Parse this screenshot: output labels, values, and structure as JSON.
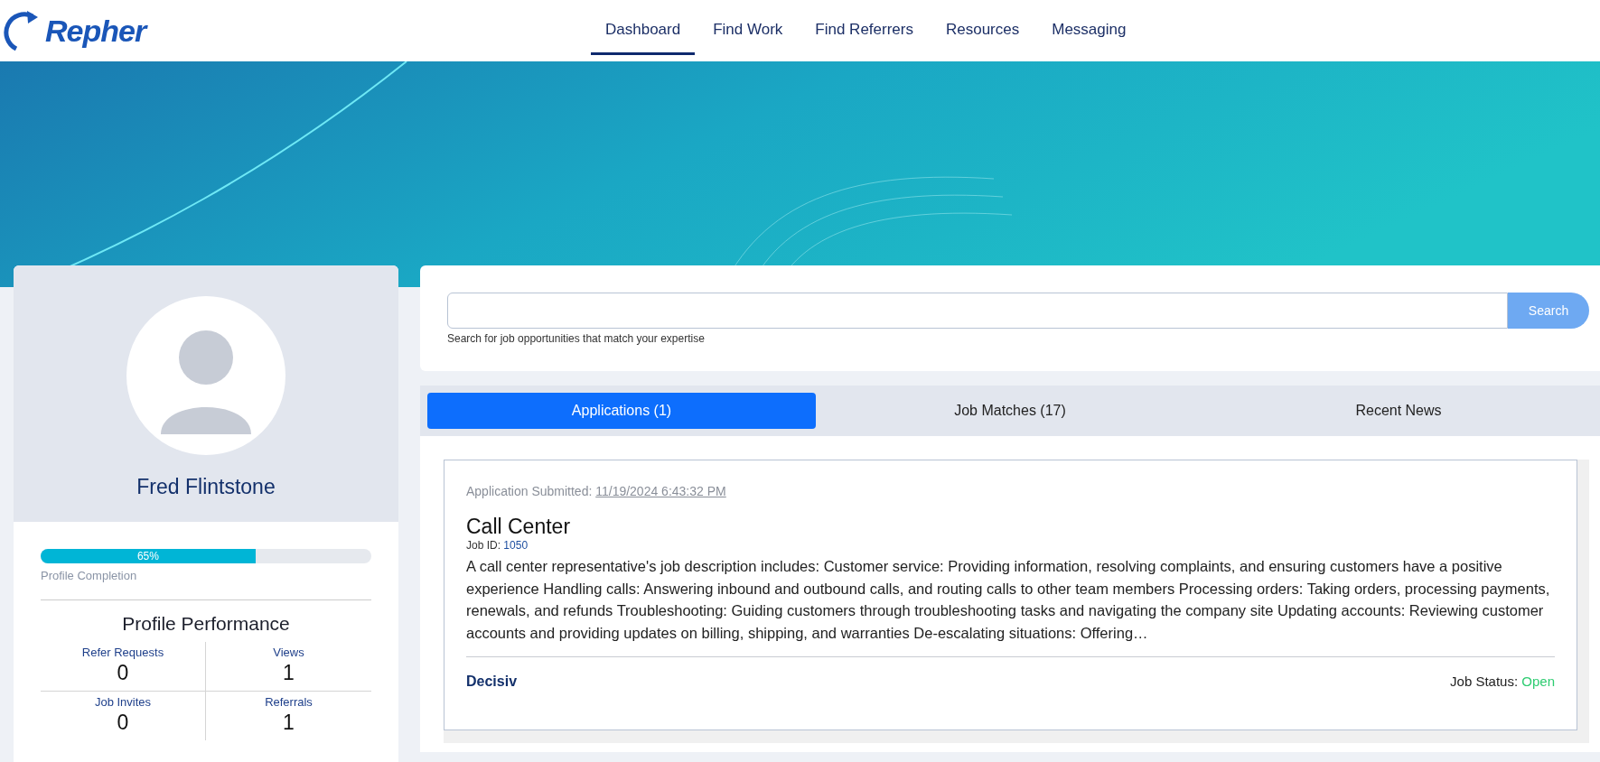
{
  "logo": {
    "text": "Repher"
  },
  "nav": [
    {
      "label": "Dashboard",
      "selected": true
    },
    {
      "label": "Find Work",
      "selected": false
    },
    {
      "label": "Find Referrers",
      "selected": false
    },
    {
      "label": "Resources",
      "selected": false
    },
    {
      "label": "Messaging",
      "selected": false
    }
  ],
  "profile": {
    "name": "Fred Flintstone",
    "completion": {
      "level": 0.65,
      "reading": "65%",
      "label": "Profile Completion"
    },
    "performance": {
      "title": "Profile Performance",
      "stats": [
        {
          "label": "Refer Requests",
          "value": "0"
        },
        {
          "label": "Views",
          "value": "1"
        },
        {
          "label": "Job Invites",
          "value": "0"
        },
        {
          "label": "Referrals",
          "value": "1"
        }
      ]
    }
  },
  "search": {
    "button": "Search",
    "hint": "Search for job opportunities that match your expertise"
  },
  "tabs": [
    {
      "label": "Applications (1)",
      "selected": true
    },
    {
      "label": "Job Matches (17)",
      "selected": false
    },
    {
      "label": "Recent News",
      "selected": false
    }
  ],
  "application": {
    "submitted_label": "Application Submitted:",
    "submitted_date": "11/19/2024 6:43:32 PM",
    "title": "Call Center",
    "job_id_label": "Job ID:",
    "job_id": "1050",
    "description": "A call center representative's job description includes: Customer service: Providing information, resolving complaints, and ensuring customers have a positive experience Handling calls: Answering inbound and outbound calls, and routing calls to other team members Processing orders: Taking orders, processing payments, renewals, and refunds Troubleshooting: Guiding customers through troubleshooting tasks and navigating the company site Updating accounts: Reviewing customer accounts and providing updates on billing, shipping, and warranties De-escalating situations: Offering…",
    "company": "Decisiv",
    "status_label": "Job Status:",
    "status": "Open"
  }
}
